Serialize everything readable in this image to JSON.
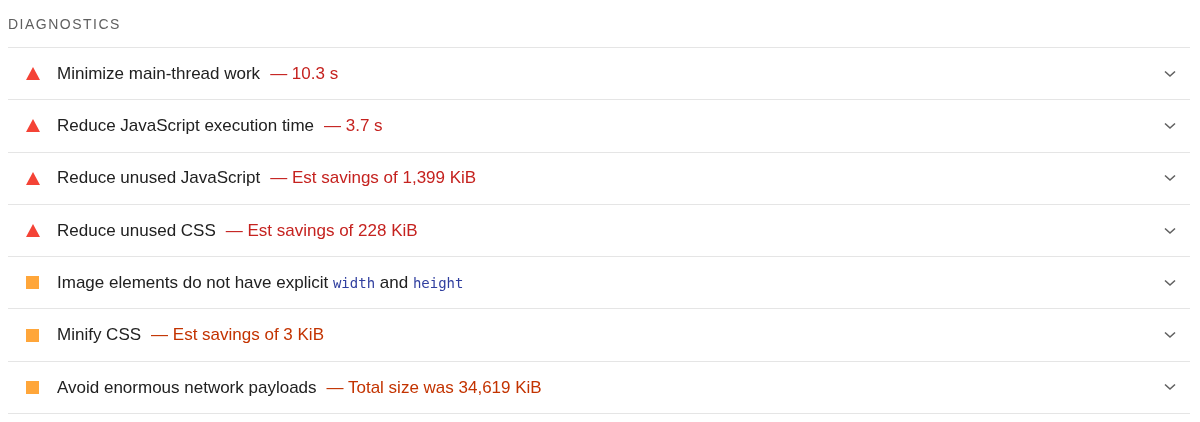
{
  "section_title": "DIAGNOSTICS",
  "audits": [
    {
      "kind": "fail",
      "title": [
        {
          "kind": "text",
          "text": "Minimize main-thread work"
        }
      ],
      "display_value": "— 10.3 s"
    },
    {
      "kind": "fail",
      "title": [
        {
          "kind": "text",
          "text": "Reduce JavaScript execution time"
        }
      ],
      "display_value": "— 3.7 s"
    },
    {
      "kind": "fail",
      "title": [
        {
          "kind": "text",
          "text": "Reduce unused JavaScript"
        }
      ],
      "display_value": "— Est savings of 1,399 KiB"
    },
    {
      "kind": "fail",
      "title": [
        {
          "kind": "text",
          "text": "Reduce unused CSS"
        }
      ],
      "display_value": "— Est savings of 228 KiB"
    },
    {
      "kind": "average",
      "title": [
        {
          "kind": "text",
          "text": "Image elements do not have explicit "
        },
        {
          "kind": "code",
          "text": "width"
        },
        {
          "kind": "text",
          "text": " and "
        },
        {
          "kind": "code",
          "text": "height"
        }
      ]
    },
    {
      "kind": "average",
      "title": [
        {
          "kind": "text",
          "text": "Minify CSS"
        }
      ],
      "display_value": "— Est savings of 3 KiB"
    },
    {
      "kind": "average",
      "title": [
        {
          "kind": "text",
          "text": "Avoid enormous network payloads"
        }
      ],
      "display_value": "— Total size was 34,619 KiB"
    }
  ]
}
